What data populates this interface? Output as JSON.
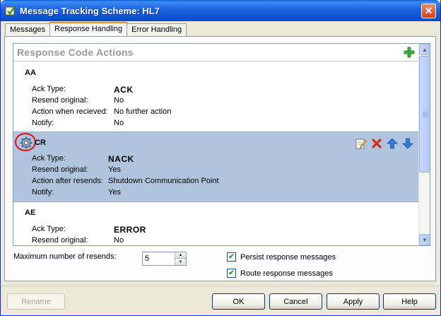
{
  "window": {
    "title": "Message Tracking Scheme: HL7",
    "close_glyph": "✕"
  },
  "tabs": [
    {
      "label": "Messages",
      "active": false
    },
    {
      "label": "Response Handling",
      "active": true
    },
    {
      "label": "Error Handling",
      "active": false
    }
  ],
  "list": {
    "header": "Response Code Actions",
    "entries": [
      {
        "code": "AA",
        "rows": [
          {
            "label": "Ack Type:",
            "value": "ACK",
            "strong": true
          },
          {
            "label": "Resend original:",
            "value": "No"
          },
          {
            "label": "Action when recieved:",
            "value": "No further action"
          },
          {
            "label": "Notify:",
            "value": "No"
          }
        ]
      },
      {
        "code": "CR",
        "selected": true,
        "rows": [
          {
            "label": "Ack Type:",
            "value": "NACK",
            "strong": true
          },
          {
            "label": "Resend original:",
            "value": "Yes"
          },
          {
            "label": "Action after resends:",
            "value": "Shutdown Communication Point"
          },
          {
            "label": "Notify:",
            "value": "Yes"
          }
        ]
      },
      {
        "code": "AE",
        "rows": [
          {
            "label": "Ack Type:",
            "value": "ERROR",
            "strong": true
          },
          {
            "label": "Resend original:",
            "value": "No"
          }
        ]
      }
    ]
  },
  "settings": {
    "max_resends_label": "Maximum number of resends:",
    "max_resends_value": "5",
    "persist_label": "Persist response messages",
    "persist_checked": true,
    "route_label": "Route response messages",
    "route_checked": true
  },
  "buttons": {
    "rename": "Rename",
    "ok": "OK",
    "cancel": "Cancel",
    "apply": "Apply",
    "help": "Help"
  },
  "icons": {
    "title": "app-icon",
    "add": "add-icon",
    "gear": "gear-icon",
    "edit": "edit-icon",
    "delete": "delete-icon",
    "up": "arrow-up-icon",
    "down": "arrow-down-icon"
  },
  "colors": {
    "selected_row": "#b0c4de",
    "title_bar": "#0b4fd0",
    "highlight_circle": "#e01010"
  }
}
